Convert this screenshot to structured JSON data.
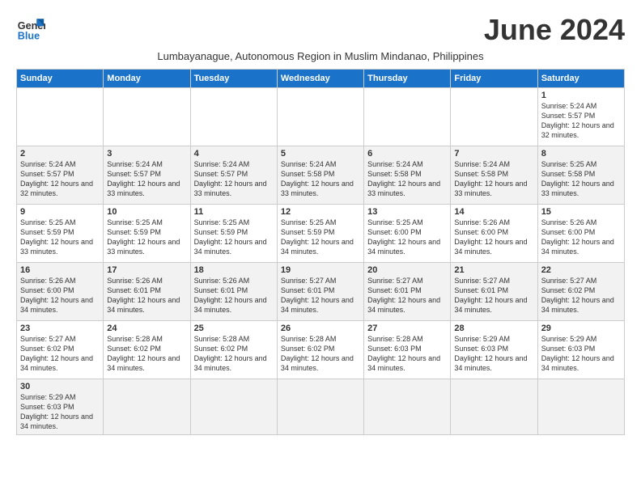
{
  "header": {
    "logo_general": "General",
    "logo_blue": "Blue",
    "month_title": "June 2024",
    "subtitle": "Lumbayanague, Autonomous Region in Muslim Mindanao, Philippines"
  },
  "weekdays": [
    "Sunday",
    "Monday",
    "Tuesday",
    "Wednesday",
    "Thursday",
    "Friday",
    "Saturday"
  ],
  "weeks": [
    [
      {
        "day": "",
        "info": ""
      },
      {
        "day": "",
        "info": ""
      },
      {
        "day": "",
        "info": ""
      },
      {
        "day": "",
        "info": ""
      },
      {
        "day": "",
        "info": ""
      },
      {
        "day": "",
        "info": ""
      },
      {
        "day": "1",
        "info": "Sunrise: 5:24 AM\nSunset: 5:57 PM\nDaylight: 12 hours and 32 minutes."
      }
    ],
    [
      {
        "day": "2",
        "info": "Sunrise: 5:24 AM\nSunset: 5:57 PM\nDaylight: 12 hours and 32 minutes."
      },
      {
        "day": "3",
        "info": "Sunrise: 5:24 AM\nSunset: 5:57 PM\nDaylight: 12 hours and 33 minutes."
      },
      {
        "day": "4",
        "info": "Sunrise: 5:24 AM\nSunset: 5:57 PM\nDaylight: 12 hours and 33 minutes."
      },
      {
        "day": "5",
        "info": "Sunrise: 5:24 AM\nSunset: 5:58 PM\nDaylight: 12 hours and 33 minutes."
      },
      {
        "day": "6",
        "info": "Sunrise: 5:24 AM\nSunset: 5:58 PM\nDaylight: 12 hours and 33 minutes."
      },
      {
        "day": "7",
        "info": "Sunrise: 5:24 AM\nSunset: 5:58 PM\nDaylight: 12 hours and 33 minutes."
      },
      {
        "day": "8",
        "info": "Sunrise: 5:25 AM\nSunset: 5:58 PM\nDaylight: 12 hours and 33 minutes."
      }
    ],
    [
      {
        "day": "9",
        "info": "Sunrise: 5:25 AM\nSunset: 5:59 PM\nDaylight: 12 hours and 33 minutes."
      },
      {
        "day": "10",
        "info": "Sunrise: 5:25 AM\nSunset: 5:59 PM\nDaylight: 12 hours and 33 minutes."
      },
      {
        "day": "11",
        "info": "Sunrise: 5:25 AM\nSunset: 5:59 PM\nDaylight: 12 hours and 34 minutes."
      },
      {
        "day": "12",
        "info": "Sunrise: 5:25 AM\nSunset: 5:59 PM\nDaylight: 12 hours and 34 minutes."
      },
      {
        "day": "13",
        "info": "Sunrise: 5:25 AM\nSunset: 6:00 PM\nDaylight: 12 hours and 34 minutes."
      },
      {
        "day": "14",
        "info": "Sunrise: 5:26 AM\nSunset: 6:00 PM\nDaylight: 12 hours and 34 minutes."
      },
      {
        "day": "15",
        "info": "Sunrise: 5:26 AM\nSunset: 6:00 PM\nDaylight: 12 hours and 34 minutes."
      }
    ],
    [
      {
        "day": "16",
        "info": "Sunrise: 5:26 AM\nSunset: 6:00 PM\nDaylight: 12 hours and 34 minutes."
      },
      {
        "day": "17",
        "info": "Sunrise: 5:26 AM\nSunset: 6:01 PM\nDaylight: 12 hours and 34 minutes."
      },
      {
        "day": "18",
        "info": "Sunrise: 5:26 AM\nSunset: 6:01 PM\nDaylight: 12 hours and 34 minutes."
      },
      {
        "day": "19",
        "info": "Sunrise: 5:27 AM\nSunset: 6:01 PM\nDaylight: 12 hours and 34 minutes."
      },
      {
        "day": "20",
        "info": "Sunrise: 5:27 AM\nSunset: 6:01 PM\nDaylight: 12 hours and 34 minutes."
      },
      {
        "day": "21",
        "info": "Sunrise: 5:27 AM\nSunset: 6:01 PM\nDaylight: 12 hours and 34 minutes."
      },
      {
        "day": "22",
        "info": "Sunrise: 5:27 AM\nSunset: 6:02 PM\nDaylight: 12 hours and 34 minutes."
      }
    ],
    [
      {
        "day": "23",
        "info": "Sunrise: 5:27 AM\nSunset: 6:02 PM\nDaylight: 12 hours and 34 minutes."
      },
      {
        "day": "24",
        "info": "Sunrise: 5:28 AM\nSunset: 6:02 PM\nDaylight: 12 hours and 34 minutes."
      },
      {
        "day": "25",
        "info": "Sunrise: 5:28 AM\nSunset: 6:02 PM\nDaylight: 12 hours and 34 minutes."
      },
      {
        "day": "26",
        "info": "Sunrise: 5:28 AM\nSunset: 6:02 PM\nDaylight: 12 hours and 34 minutes."
      },
      {
        "day": "27",
        "info": "Sunrise: 5:28 AM\nSunset: 6:03 PM\nDaylight: 12 hours and 34 minutes."
      },
      {
        "day": "28",
        "info": "Sunrise: 5:29 AM\nSunset: 6:03 PM\nDaylight: 12 hours and 34 minutes."
      },
      {
        "day": "29",
        "info": "Sunrise: 5:29 AM\nSunset: 6:03 PM\nDaylight: 12 hours and 34 minutes."
      }
    ],
    [
      {
        "day": "30",
        "info": "Sunrise: 5:29 AM\nSunset: 6:03 PM\nDaylight: 12 hours and 34 minutes."
      },
      {
        "day": "",
        "info": ""
      },
      {
        "day": "",
        "info": ""
      },
      {
        "day": "",
        "info": ""
      },
      {
        "day": "",
        "info": ""
      },
      {
        "day": "",
        "info": ""
      },
      {
        "day": "",
        "info": ""
      }
    ]
  ]
}
